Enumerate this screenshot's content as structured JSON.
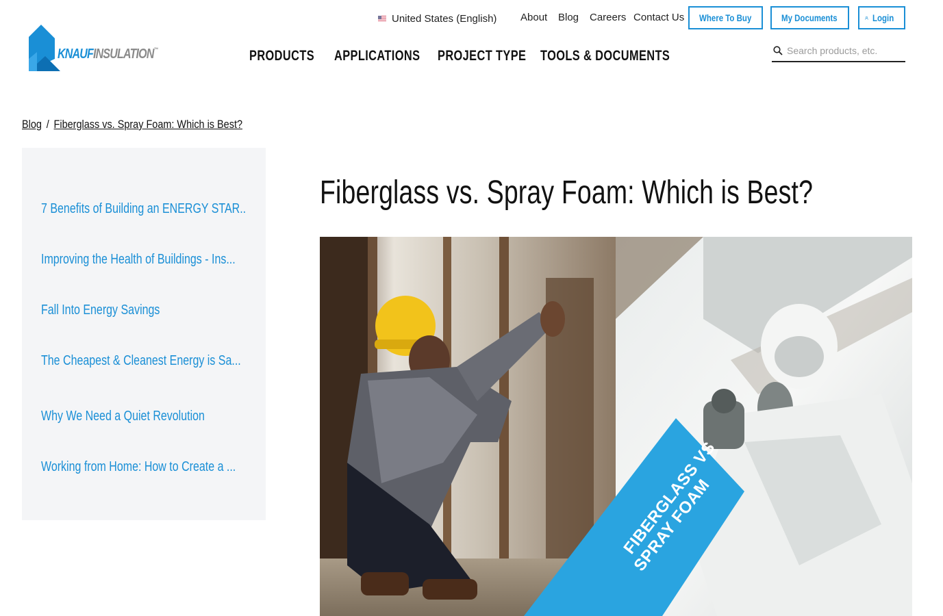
{
  "brand": {
    "logo_text_main": "KNAUF",
    "logo_text_sub": "INSULATION",
    "logo_tm": "™",
    "accent_color": "#1a8fd6"
  },
  "utility": {
    "locale": "United States (English)",
    "links": [
      "About",
      "Blog",
      "Careers",
      "Contact Us"
    ],
    "where_to_buy": "Where To Buy",
    "my_documents": "My Documents",
    "login": "Login"
  },
  "nav": {
    "items": [
      "PRODUCTS",
      "APPLICATIONS",
      "PROJECT TYPE",
      "TOOLS & DOCUMENTS"
    ]
  },
  "search": {
    "placeholder": "Search products, etc."
  },
  "breadcrumb": {
    "root": "Blog",
    "separator": "/",
    "current": "Fiberglass vs. Spray Foam: Which is Best?"
  },
  "sidebar": {
    "items": [
      "7 Benefits of Building an ENERGY STAR...",
      "Improving the Health of Buildings - Ins...",
      "Fall Into Energy Savings",
      "The Cheapest & Cleanest Energy is Sa...",
      "Why We Need a Quiet Revolution",
      "Working from Home: How to Create a ..."
    ]
  },
  "article": {
    "title": "Fiberglass vs. Spray Foam: Which is Best?",
    "hero_label_line1": "FIBERGLASS VS",
    "hero_label_line2": "SPRAY FOAM"
  }
}
